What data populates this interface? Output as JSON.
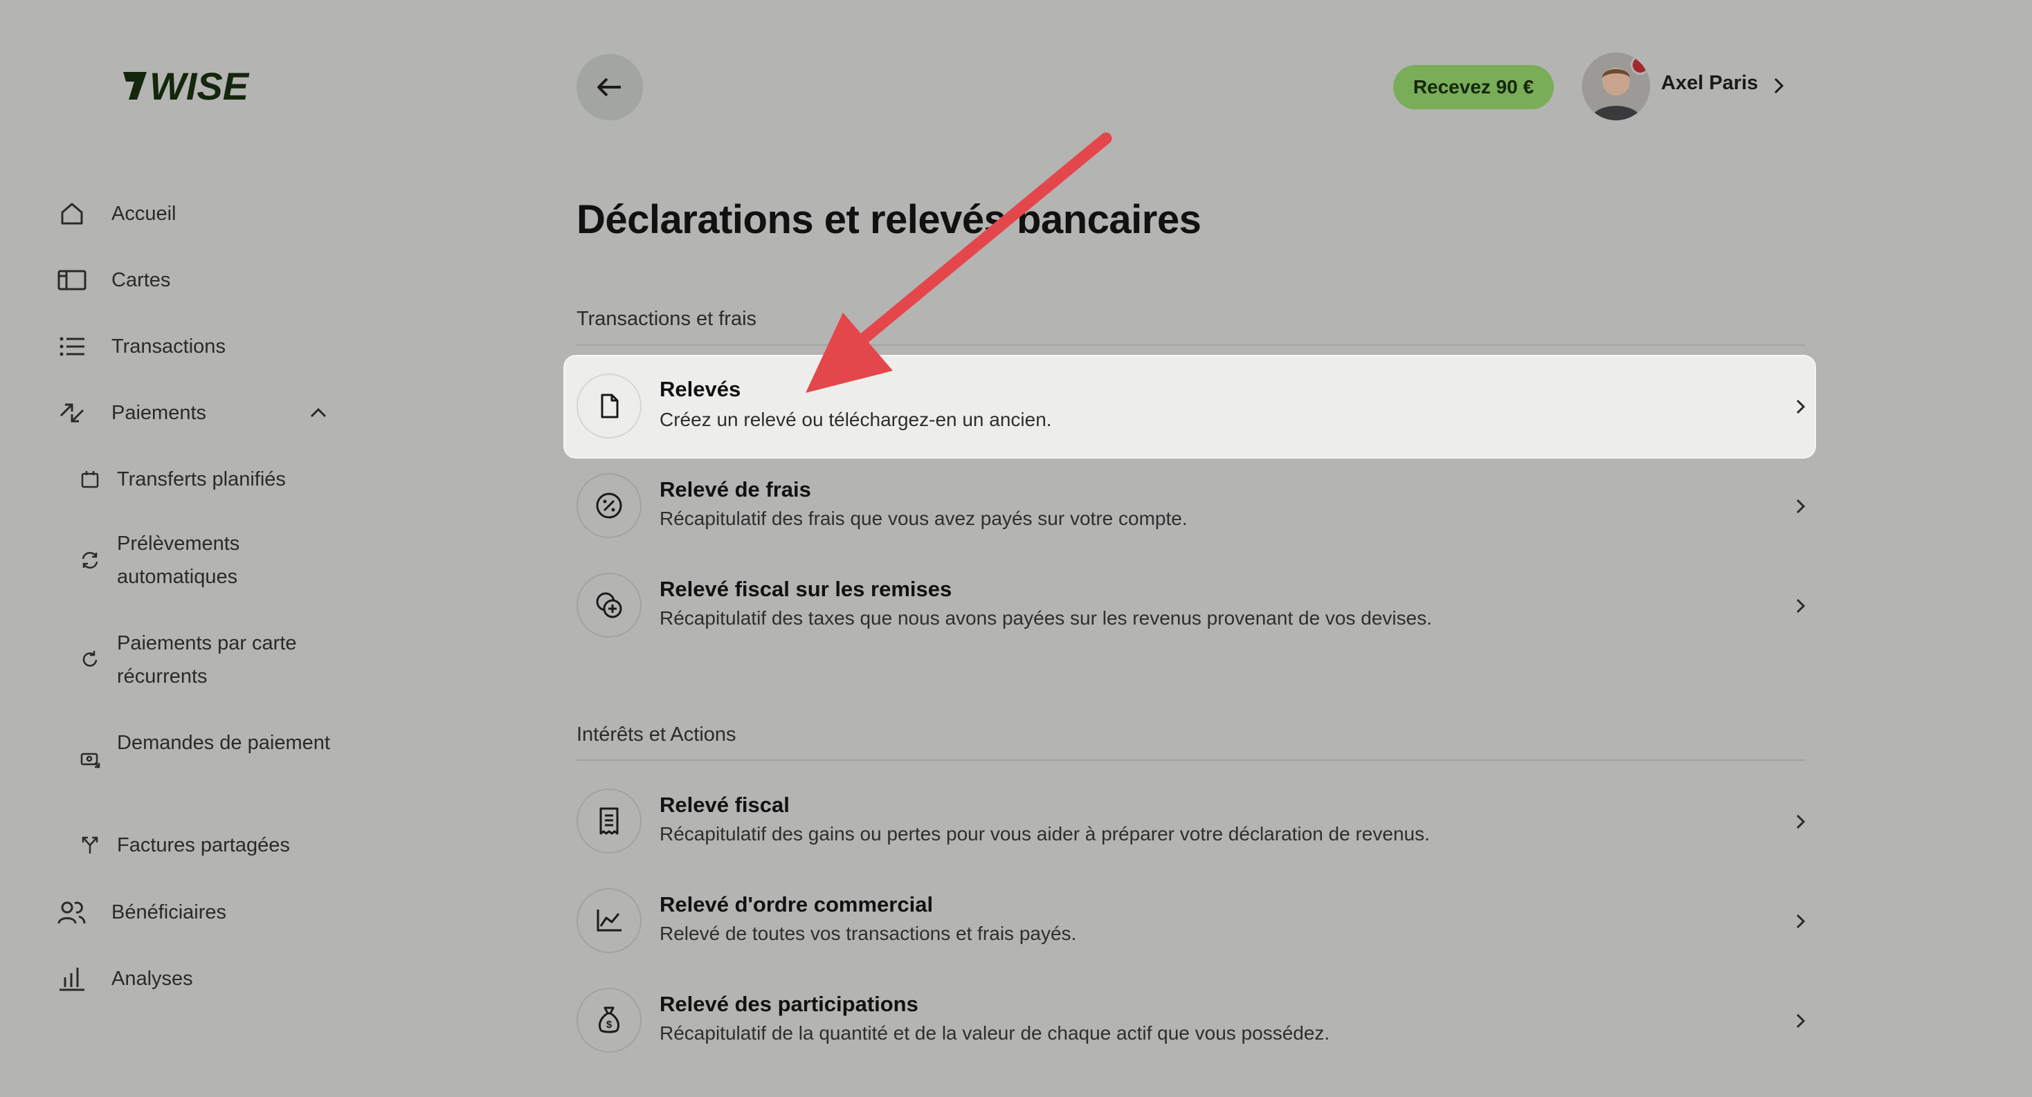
{
  "brand": {
    "logo_text": "WISE",
    "color": "#14260c"
  },
  "sidebar": {
    "items": [
      {
        "label": "Accueil",
        "icon": "home-icon"
      },
      {
        "label": "Cartes",
        "icon": "card-icon"
      },
      {
        "label": "Transactions",
        "icon": "list-icon"
      },
      {
        "label": "Paiements",
        "icon": "transfer-arrows-icon",
        "expanded": true
      },
      {
        "label": "Bénéficiaires",
        "icon": "recipients-icon"
      },
      {
        "label": "Analyses",
        "icon": "bar-chart-icon"
      }
    ],
    "sub_items": [
      {
        "label": "Transferts planifiés",
        "icon": "calendar-icon"
      },
      {
        "label": "Prélèvements automatiques",
        "icon": "refresh-icon"
      },
      {
        "label": "Paiements par carte récurrents",
        "icon": "recurring-icon"
      },
      {
        "label": "Demandes de paiement",
        "icon": "payment-request-icon"
      },
      {
        "label": "Factures partagées",
        "icon": "split-icon"
      }
    ]
  },
  "header": {
    "promo_label": "Recevez 90 €",
    "promo_color": "#79ad58",
    "user_name": "Axel Paris"
  },
  "main": {
    "title": "Déclarations et relevés bancaires",
    "sections": [
      {
        "title": "Transactions et frais",
        "rows": [
          {
            "title": "Relevés",
            "desc": "Créez un relevé ou téléchargez-en un ancien.",
            "icon": "document-icon",
            "highlighted": true
          },
          {
            "title": "Relevé de frais",
            "desc": "Récapitulatif des frais que vous avez payés sur votre compte.",
            "icon": "percent-icon"
          },
          {
            "title": "Relevé fiscal sur les remises",
            "desc": "Récapitulatif des taxes que nous avons payées sur les revenus provenant de vos devises.",
            "icon": "coins-plus-icon"
          }
        ]
      },
      {
        "title": "Intérêts et Actions",
        "rows": [
          {
            "title": "Relevé fiscal",
            "desc": "Récapitulatif des gains ou pertes pour vous aider à préparer votre déclaration de revenus.",
            "icon": "receipt-icon"
          },
          {
            "title": "Relevé d'ordre commercial",
            "desc": "Relevé de toutes vos transactions et frais payés.",
            "icon": "line-chart-icon"
          },
          {
            "title": "Relevé des participations",
            "desc": "Récapitulatif de la quantité et de la valeur de chaque actif que vous possédez.",
            "icon": "money-bag-icon"
          }
        ]
      }
    ]
  },
  "annotation": {
    "arrow_color": "#e4474b"
  }
}
